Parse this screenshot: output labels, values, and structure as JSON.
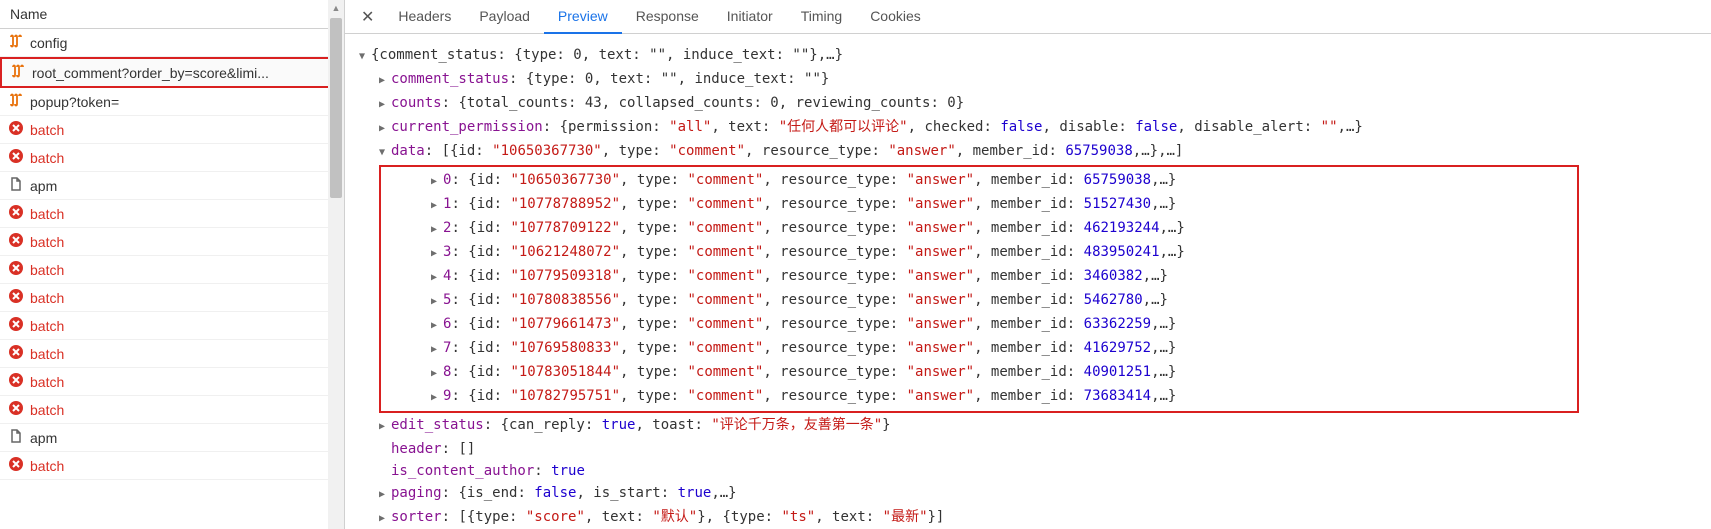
{
  "sidebar": {
    "header": "Name",
    "items": [
      {
        "type": "fetch",
        "label": "config",
        "error": false
      },
      {
        "type": "fetch",
        "label": "root_comment?order_by=score&limi...",
        "error": false,
        "highlighted": true
      },
      {
        "type": "fetch",
        "label": "popup?token=",
        "error": false
      },
      {
        "type": "error",
        "label": "batch",
        "error": true
      },
      {
        "type": "error",
        "label": "batch",
        "error": true
      },
      {
        "type": "doc",
        "label": "apm",
        "error": false
      },
      {
        "type": "error",
        "label": "batch",
        "error": true
      },
      {
        "type": "error",
        "label": "batch",
        "error": true
      },
      {
        "type": "error",
        "label": "batch",
        "error": true
      },
      {
        "type": "error",
        "label": "batch",
        "error": true
      },
      {
        "type": "error",
        "label": "batch",
        "error": true
      },
      {
        "type": "error",
        "label": "batch",
        "error": true
      },
      {
        "type": "error",
        "label": "batch",
        "error": true
      },
      {
        "type": "error",
        "label": "batch",
        "error": true
      },
      {
        "type": "doc",
        "label": "apm",
        "error": false
      },
      {
        "type": "error",
        "label": "batch",
        "error": true
      }
    ]
  },
  "tabs": {
    "items": [
      "Headers",
      "Payload",
      "Preview",
      "Response",
      "Initiator",
      "Timing",
      "Cookies"
    ],
    "active": "Preview"
  },
  "preview": {
    "root_summary": "{comment_status: {type: 0, text: \"\", induce_text: \"\"},…}",
    "comment_status": "{type: 0, text: \"\", induce_text: \"\"}",
    "counts": "{total_counts: 43, collapsed_counts: 0, reviewing_counts: 0}",
    "current_permission": "{permission: \"all\", text: \"任何人都可以评论\", checked: false, disable: false, disable_alert: \"\",…}",
    "data_summary": "[{id: \"10650367730\", type: \"comment\", resource_type: \"answer\", member_id: 65759038,…},…]",
    "data_items": [
      {
        "idx": 0,
        "id": "10650367730",
        "type": "comment",
        "resource_type": "answer",
        "member_id": 65759038
      },
      {
        "idx": 1,
        "id": "10778788952",
        "type": "comment",
        "resource_type": "answer",
        "member_id": 51527430
      },
      {
        "idx": 2,
        "id": "10778709122",
        "type": "comment",
        "resource_type": "answer",
        "member_id": 462193244
      },
      {
        "idx": 3,
        "id": "10621248072",
        "type": "comment",
        "resource_type": "answer",
        "member_id": 483950241
      },
      {
        "idx": 4,
        "id": "10779509318",
        "type": "comment",
        "resource_type": "answer",
        "member_id": 3460382
      },
      {
        "idx": 5,
        "id": "10780838556",
        "type": "comment",
        "resource_type": "answer",
        "member_id": 5462780
      },
      {
        "idx": 6,
        "id": "10779661473",
        "type": "comment",
        "resource_type": "answer",
        "member_id": 63362259
      },
      {
        "idx": 7,
        "id": "10769580833",
        "type": "comment",
        "resource_type": "answer",
        "member_id": 41629752
      },
      {
        "idx": 8,
        "id": "10783051844",
        "type": "comment",
        "resource_type": "answer",
        "member_id": 40901251
      },
      {
        "idx": 9,
        "id": "10782795751",
        "type": "comment",
        "resource_type": "answer",
        "member_id": 73683414
      }
    ],
    "edit_status": "{can_reply: true, toast: \"评论千万条，友善第一条\"}",
    "header_value": "[]",
    "is_content_author": "true",
    "paging": "{is_end: false, is_start: true,…}",
    "sorter": "[{type: \"score\", text: \"默认\"}, {type: \"ts\", text: \"最新\"}]"
  }
}
